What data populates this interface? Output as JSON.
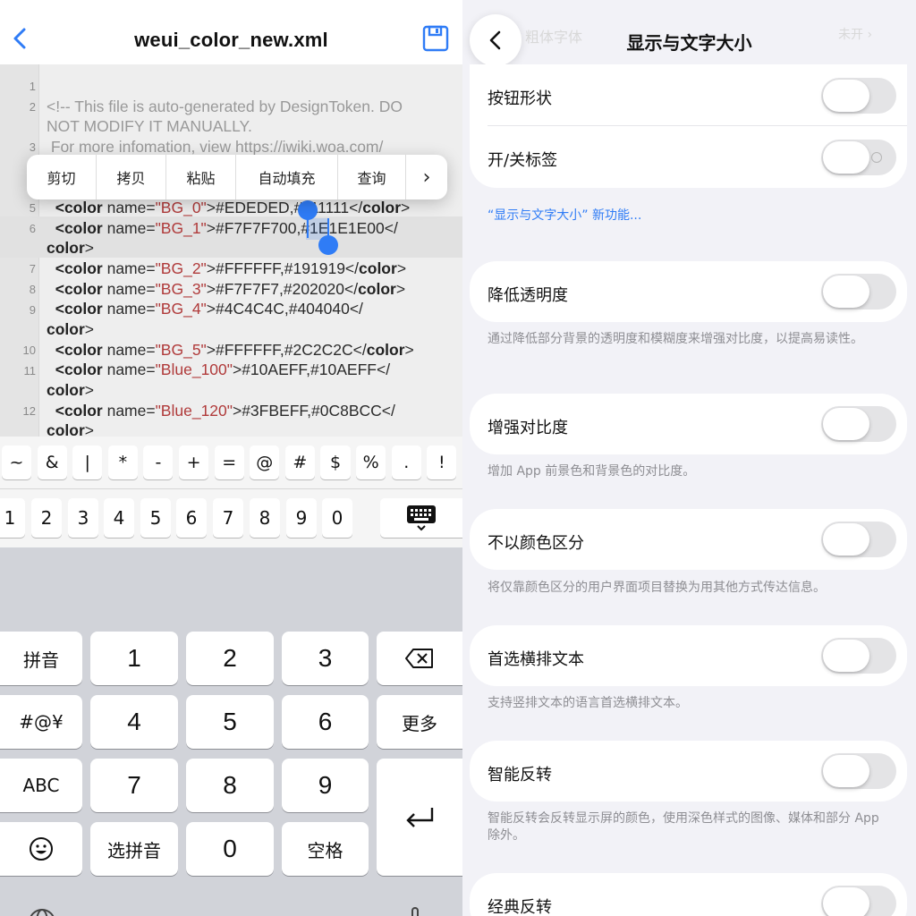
{
  "editor": {
    "filename": "weui_color_new.xml",
    "line_numbers": [
      "1",
      "2",
      "3",
      "5",
      "6",
      "7",
      "8",
      "9",
      "10",
      "11",
      "12"
    ],
    "lines": {
      "l2a": "<!-- This file is auto-generated by DesignToken. DO",
      "l2b": "NOT MODIFY IT MANUALLY.",
      "l3": " For more infomation, view https://iwiki.woa.com/",
      "l5_tag_open": "  <color",
      "l5_name": " name=",
      "l5_val": "\"BG_0\"",
      "l5_rest": ">#EDEDED,#111111</",
      "l5_close": "color",
      "l6_tag_open": "  <color",
      "l6_name": " name=",
      "l6_val": "\"BG_1\"",
      "l6_rest": ">#F7F7F700,#1E1E1E00</",
      "l6b_close": "color",
      "l6b_end": ">",
      "l7_tag_open": "  <color",
      "l7_name": " name=",
      "l7_val": "\"BG_2\"",
      "l7_rest": ">#FFFFFF,#191919</",
      "l7_close": "color",
      "l8_tag_open": "  <color",
      "l8_name": " name=",
      "l8_val": "\"BG_3\"",
      "l8_rest": ">#F7F7F7,#202020</",
      "l8_close": "color",
      "l9_tag_open": "  <color",
      "l9_name": " name=",
      "l9_val": "\"BG_4\"",
      "l9_rest": ">#4C4C4C,#404040</",
      "l9b_close": "color",
      "l9b_end": ">",
      "l10_tag_open": "  <color",
      "l10_name": " name=",
      "l10_val": "\"BG_5\"",
      "l10_rest": ">#FFFFFF,#2C2C2C</",
      "l10_close": "color",
      "l11_tag_open": "  <color",
      "l11_name": " name=",
      "l11_val": "\"Blue_100\"",
      "l11_rest": ">#10AEFF,#10AEFF</",
      "l11b_close": "color",
      "l11b_end": ">",
      "l12_tag_open": "  <color",
      "l12_name": " name=",
      "l12_val": "\"Blue_120\"",
      "l12_rest": ">#3FBEFF,#0C8BCC</",
      "l12b_close": "color",
      "l12b_end": ">"
    },
    "close_gt": ">",
    "context_menu": [
      "剪切",
      "拷贝",
      "粘贴",
      "自动填充",
      "查询",
      "›"
    ]
  },
  "keyboard": {
    "symbols": [
      "~",
      "&",
      "|",
      "*",
      "-",
      "+",
      "=",
      "@",
      "#",
      "$",
      "%",
      ".",
      "!"
    ],
    "numbers": [
      "1",
      "2",
      "3",
      "4",
      "5",
      "6",
      "7",
      "8",
      "9",
      "0"
    ],
    "keypad": {
      "pinyin": "拼音",
      "symbols": "#@¥",
      "abc": "ABC",
      "select_pinyin": "选拼音",
      "more": "更多",
      "space": "空格",
      "digits": [
        "1",
        "2",
        "3",
        "4",
        "5",
        "6",
        "7",
        "8",
        "9",
        "0"
      ]
    }
  },
  "settings": {
    "title": "显示与文字大小",
    "ghost_label": "粗体字体",
    "ghost_value": "未开 ›",
    "rows": {
      "button_shapes": "按钮形状",
      "on_off_labels": "开/关标签",
      "reduce_transparency": "降低透明度",
      "increase_contrast": "增强对比度",
      "differentiate_without_color": "不以颜色区分",
      "prefer_horizontal_text": "首选横排文本",
      "smart_invert": "智能反转",
      "classic_invert": "经典反转"
    },
    "link_new_features": "“显示与文字大小” 新功能...",
    "footnotes": {
      "reduce_transparency": "通过降低部分背景的透明度和模糊度来增强对比度，以提高易读性。",
      "increase_contrast": "增加 App 前景色和背景色的对比度。",
      "differentiate_without_color": "将仅靠颜色区分的用户界面项目替换为用其他方式传达信息。",
      "prefer_horizontal_text": "支持竖排文本的语言首选横排文本。",
      "smart_invert": "智能反转会反转显示屏的颜色，使用深色样式的图像、媒体和部分 App 除外。"
    },
    "toggles": {
      "button_shapes": false,
      "on_off_labels": false,
      "reduce_transparency": false,
      "increase_contrast": false,
      "differentiate_without_color": false,
      "prefer_horizontal_text": false,
      "smart_invert": false,
      "classic_invert": false
    }
  },
  "colors": {
    "accent_blue": "#2f7cf6",
    "code_string_red": "#b03a3a",
    "comment_gray": "#999999"
  }
}
